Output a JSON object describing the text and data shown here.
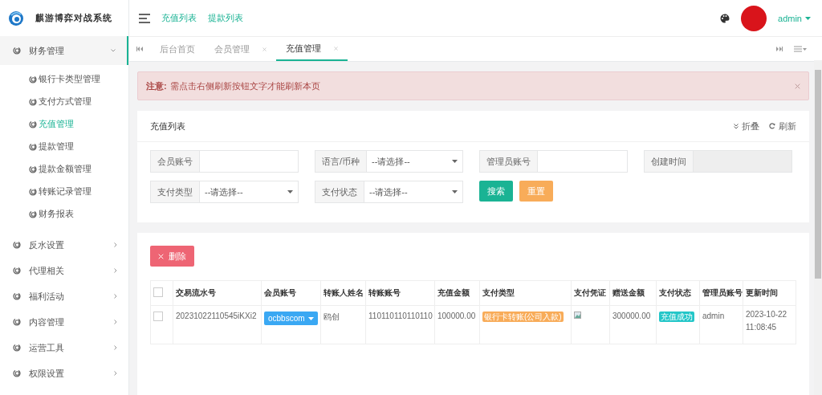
{
  "header": {
    "title": "麒游博弈对战系统",
    "nav_links": [
      "充值列表",
      "提款列表"
    ],
    "user": "admin"
  },
  "sidebar": {
    "items": [
      {
        "label": "财务管理",
        "expanded": true,
        "children": [
          {
            "label": "银行卡类型管理",
            "selected": false
          },
          {
            "label": "支付方式管理",
            "selected": false
          },
          {
            "label": "充值管理",
            "selected": true
          },
          {
            "label": "提款管理",
            "selected": false
          },
          {
            "label": "提款金额管理",
            "selected": false
          },
          {
            "label": "转账记录管理",
            "selected": false
          },
          {
            "label": "财务报表",
            "selected": false
          }
        ]
      },
      {
        "label": "反水设置",
        "expanded": false
      },
      {
        "label": "代理相关",
        "expanded": false
      },
      {
        "label": "福利活动",
        "expanded": false
      },
      {
        "label": "内容管理",
        "expanded": false
      },
      {
        "label": "运营工具",
        "expanded": false
      },
      {
        "label": "权限设置",
        "expanded": false
      }
    ]
  },
  "tabs": [
    {
      "label": "后台首页",
      "selected": false,
      "closable": false
    },
    {
      "label": "会员管理",
      "selected": false,
      "closable": true
    },
    {
      "label": "充值管理",
      "selected": true,
      "closable": true
    }
  ],
  "alert": {
    "label": "注意:",
    "message": "需点击右侧刷新按钮文字才能刷新本页"
  },
  "search_panel": {
    "title": "充值列表",
    "actions": [
      {
        "kind": "collapse",
        "label": "折叠"
      },
      {
        "kind": "refresh",
        "label": "刷新"
      }
    ],
    "fields": [
      {
        "kind": "text",
        "label": "会员账号"
      },
      {
        "kind": "select",
        "label": "语言/币种",
        "value": "--请选择--"
      },
      {
        "kind": "text",
        "label": "管理员账号"
      },
      {
        "kind": "date",
        "label": "创建时间"
      },
      {
        "kind": "select",
        "label": "支付类型",
        "value": "--请选择--"
      },
      {
        "kind": "select",
        "label": "支付状态",
        "value": "--请选择--"
      }
    ],
    "buttons": [
      {
        "label": "搜索",
        "color": "#1ab394"
      },
      {
        "label": "重置",
        "color": "#f8ac59"
      }
    ]
  },
  "table": {
    "delete_button": "删除",
    "all_checked": false,
    "columns": [
      "交易流水号",
      "会员账号",
      "转账人姓名",
      "转账账号",
      "充值金额",
      "支付类型",
      "支付凭证",
      "赠送金额",
      "支付状态",
      "管理员账号",
      "更新时间"
    ],
    "rows": [
      {
        "checked": false,
        "cells": [
          {
            "kind": "text",
            "text": "20231022110545iKXi2"
          },
          {
            "kind": "dropdown",
            "text": "ocbbscom"
          },
          {
            "kind": "text",
            "text": "鸥创"
          },
          {
            "kind": "text",
            "text": "110110110110110"
          },
          {
            "kind": "text",
            "text": "100000.00"
          },
          {
            "kind": "tag",
            "text": "银行卡转账(公司入款)",
            "color": "#f8ac59"
          },
          {
            "kind": "image"
          },
          {
            "kind": "text",
            "text": "300000.00"
          },
          {
            "kind": "tag",
            "text": "充值成功",
            "color": "#23c6c8"
          },
          {
            "kind": "text",
            "text": "admin"
          },
          {
            "kind": "text",
            "text": "2023-10-22 11:08:45"
          }
        ]
      }
    ]
  }
}
